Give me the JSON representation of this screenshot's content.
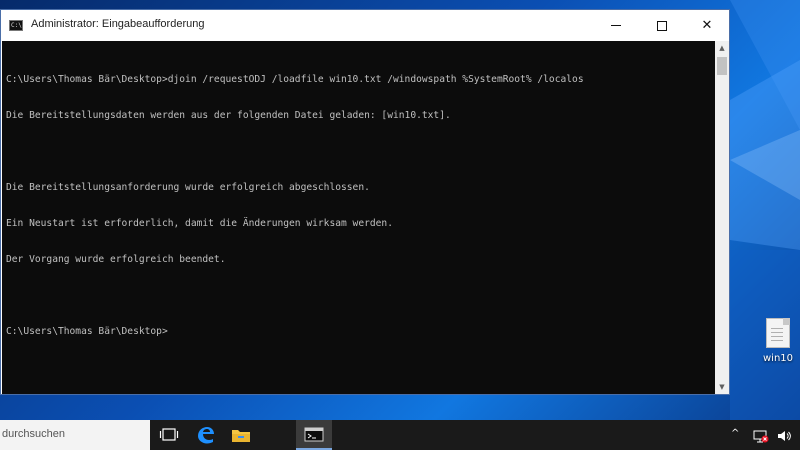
{
  "window": {
    "title": "Administrator: Eingabeaufforderung",
    "icon_text": "C:\\"
  },
  "console": {
    "lines": [
      "C:\\Users\\Thomas Bär\\Desktop>djoin /requestODJ /loadfile win10.txt /windowspath %SystemRoot% /localos",
      "Die Bereitstellungsdaten werden aus der folgenden Datei geladen: [win10.txt].",
      "",
      "Die Bereitstellungsanforderung wurde erfolgreich abgeschlossen.",
      "Ein Neustart ist erforderlich, damit die Änderungen wirksam werden.",
      "Der Vorgang wurde erfolgreich beendet.",
      "",
      "C:\\Users\\Thomas Bär\\Desktop>"
    ]
  },
  "desktop": {
    "icon_label": "win10"
  },
  "taskbar": {
    "search_text": "durchsuchen"
  },
  "icons": {
    "minimize": "minimize-icon",
    "maximize": "maximize-icon",
    "close": "close-icon",
    "taskview": "task-view-icon",
    "edge": "edge-icon",
    "explorer": "folder-icon",
    "cmd": "command-prompt-icon",
    "network": "network-error-icon",
    "volume": "speaker-icon"
  },
  "colors": {
    "console_bg": "#0c0c0c",
    "console_fg": "#c0c0c0",
    "taskbar_bg": "#1a1a1a",
    "accent": "#0b4fb3"
  }
}
